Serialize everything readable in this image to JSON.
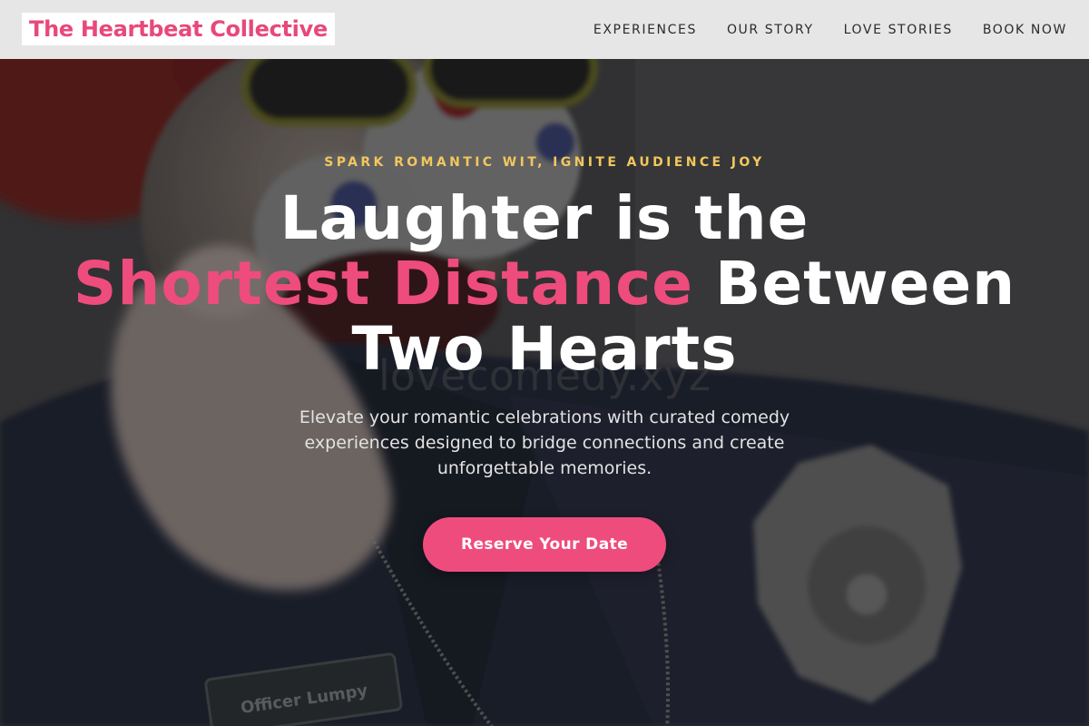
{
  "header": {
    "logo_text": "The Heartbeat Collective",
    "nav": [
      {
        "label": "EXPERIENCES"
      },
      {
        "label": "OUR STORY"
      },
      {
        "label": "LOVE STORIES"
      },
      {
        "label": "BOOK NOW"
      }
    ]
  },
  "hero": {
    "eyebrow": "SPARK ROMANTIC WIT, IGNITE AUDIENCE JOY",
    "headline": {
      "line1": "Laughter is the",
      "accent": "Shortest Distance",
      "line2_rest": " Between",
      "line3": "Two Hearts"
    },
    "subtext": "Elevate your romantic celebrations with curated comedy experiences designed to bridge connections and create unforgettable memories.",
    "cta_label": "Reserve Your Date",
    "photo_badge_text": "Officer Lumpy",
    "photo_watermark": "lovecomedy.xyz"
  },
  "colors": {
    "brand_pink": "#ee4c7c",
    "eyebrow_gold": "#f2c75c",
    "header_bg": "#e6e6e6"
  }
}
